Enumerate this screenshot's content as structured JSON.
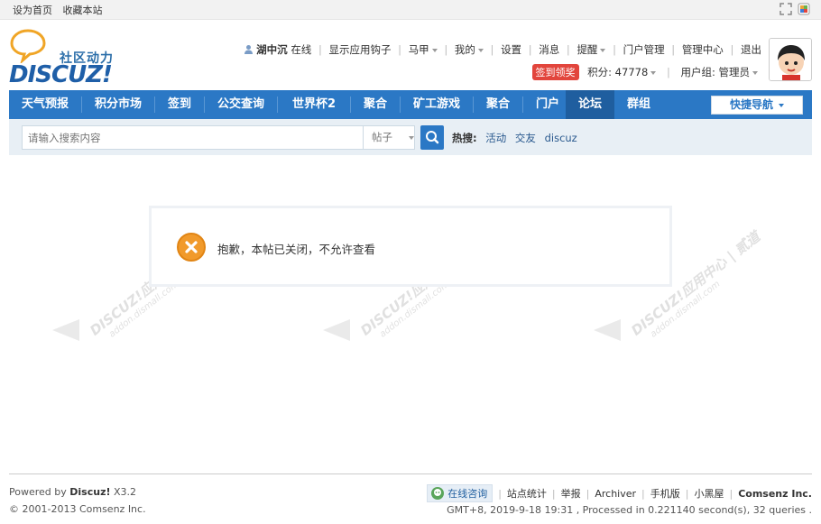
{
  "topbar": {
    "set_home": "设为首页",
    "bookmark": "收藏本站"
  },
  "logo": {
    "slogan": "社区动力",
    "word": "DISCUZ!"
  },
  "user": {
    "name": "湖中沉",
    "status": "在线",
    "links": [
      "显示应用钩子",
      "马甲",
      "我的",
      "设置",
      "消息",
      "提醒",
      "门户管理",
      "管理中心",
      "退出"
    ],
    "sign_button": "签到领奖",
    "points": "积分: 47778",
    "usergroup": "用户组: 管理员"
  },
  "nav": {
    "items": [
      "天气预报",
      "积分市场",
      "签到",
      "公交查询",
      "世界杯2",
      "聚合",
      "矿工游戏",
      "聚合",
      "门户",
      "论坛",
      "群组"
    ],
    "active": "论坛",
    "quick": "快捷导航"
  },
  "search": {
    "placeholder": "请输入搜索内容",
    "type": "帖子",
    "hot_label": "热搜:",
    "hot": [
      "活动",
      "交友",
      "discuz"
    ]
  },
  "message": {
    "text": "抱歉，本帖已关闭，不允许查看"
  },
  "watermark": {
    "main": "DISCUZ!应用中心 | 贰道",
    "sub": "addon.dismall.com"
  },
  "footer": {
    "powered_prefix": "Powered by",
    "powered_brand": "Discuz!",
    "version": "X3.2",
    "copyright": "© 2001-2013 Comsenz Inc.",
    "consult": "在线咨询",
    "links": [
      "站点统计",
      "举报",
      "Archiver",
      "手机版",
      "小黑屋"
    ],
    "company": "Comsenz Inc.",
    "gmt": "GMT+8, 2019-9-18 19:31 , Processed in 0.221140 second(s), 32 queries ."
  },
  "colors": {
    "nav_blue": "#2b78c5",
    "nav_active": "#1f5e9f",
    "sign_red": "#e2453c",
    "error_orange": "#f19a2b"
  }
}
